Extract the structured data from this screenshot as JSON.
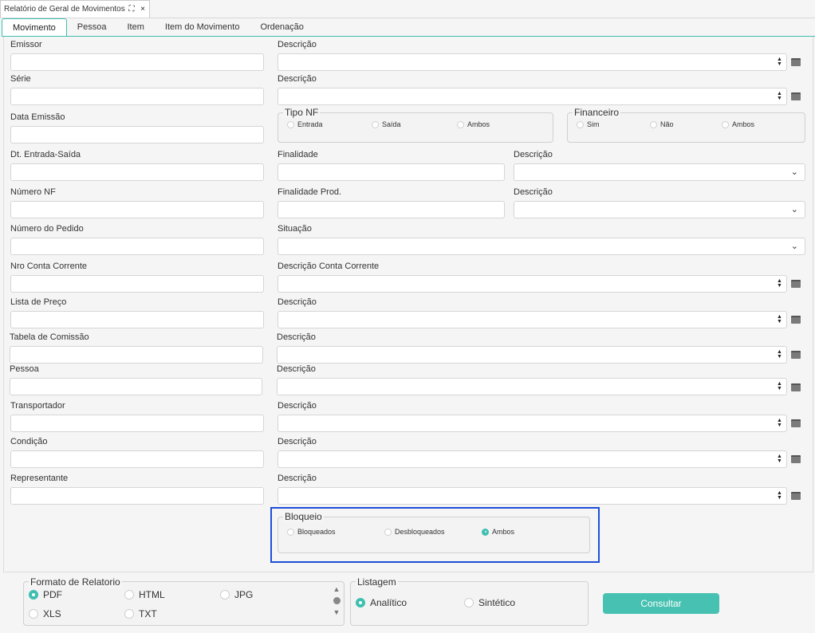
{
  "window": {
    "title": "Relatório de Geral de Movimentos",
    "maximize_icon": "maximize-icon",
    "close_icon": "×"
  },
  "tabs": [
    "Movimento",
    "Pessoa",
    "Item",
    "Item do Movimento",
    "Ordenação"
  ],
  "active_tab": "Movimento",
  "fields": {
    "emissor": "Emissor",
    "emissor_desc": "Descrição",
    "serie": "Série",
    "serie_desc": "Descrição",
    "data_emissao": "Data Emissão",
    "dt_entrada": "Dt. Entrada-Saída",
    "finalidade": "Finalidade",
    "finalidade_desc": "Descrição",
    "numero_nf": "Número NF",
    "finalidade_prod": "Finalidade Prod.",
    "finalidade_prod_desc": "Descrição",
    "numero_pedido": "Número do Pedido",
    "situacao": "Situação",
    "nro_conta": "Nro Conta Corrente",
    "desc_conta": "Descrição Conta Corrente",
    "lista_preco": "Lista de Preço",
    "lista_preco_desc": "Descrição",
    "tabela_comissao": "Tabela de Comissão",
    "tabela_comissao_desc": "Descrição",
    "pessoa": "Pessoa",
    "pessoa_desc": "Descrição",
    "transportador": "Transportador",
    "transportador_desc": "Descrição",
    "condicao": "Condição",
    "condicao_desc": "Descrição",
    "representante": "Representante",
    "representante_desc": "Descrição"
  },
  "tipo_nf": {
    "label": "Tipo NF",
    "options": [
      "Entrada",
      "Saída",
      "Ambos"
    ]
  },
  "financeiro": {
    "label": "Financeiro",
    "options": [
      "Sim",
      "Não",
      "Ambos"
    ]
  },
  "bloqueio": {
    "label": "Bloqueio",
    "options": [
      "Bloqueados",
      "Desbloqueados",
      "Ambos"
    ],
    "selected": "Ambos"
  },
  "formato": {
    "label": "Formato de Relatorio",
    "options": [
      "PDF",
      "HTML",
      "JPG",
      "XLS",
      "TXT"
    ],
    "selected": "PDF"
  },
  "listagem": {
    "label": "Listagem",
    "options": [
      "Analítico",
      "Sintético"
    ],
    "selected": "Analítico"
  },
  "consultar_label": "Consultar",
  "colors": {
    "accent": "#47c1b1",
    "highlight": "#1d4fd6"
  }
}
